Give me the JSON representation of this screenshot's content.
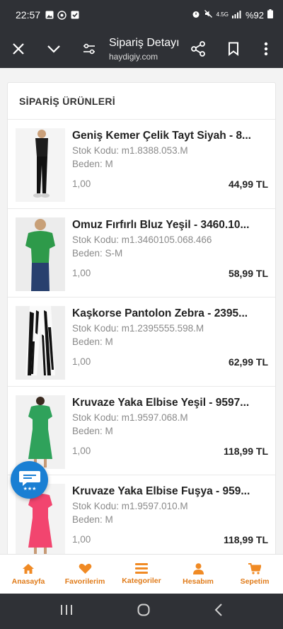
{
  "status": {
    "time": "22:57",
    "network": "4.5G",
    "battery": "%92"
  },
  "toolbar": {
    "title": "Sipariş Detayı",
    "url": "haydigiy.com"
  },
  "section_title": "SİPARİŞ ÜRÜNLERİ",
  "items": [
    {
      "name": "Geniş Kemer Çelik Tayt Siyah - 8...",
      "sku": "Stok Kodu: m1.8388.053.M",
      "size": "Beden: M",
      "qty": "1,00",
      "price": "44,99 TL",
      "image": "black-leggings"
    },
    {
      "name": "Omuz Fırfırlı Bluz Yeşil - 3460.10...",
      "sku": "Stok Kodu: m1.3460105.068.466",
      "size": "Beden: S-M",
      "qty": "1,00",
      "price": "58,99 TL",
      "image": "green-blouse"
    },
    {
      "name": "Kaşkorse Pantolon Zebra - 2395...",
      "sku": "Stok Kodu: m1.2395555.598.M",
      "size": "Beden: M",
      "qty": "1,00",
      "price": "62,99 TL",
      "image": "zebra-pants"
    },
    {
      "name": "Kruvaze Yaka Elbise Yeşil - 9597...",
      "sku": "Stok Kodu: m1.9597.068.M",
      "size": "Beden: M",
      "qty": "1,00",
      "price": "118,99 TL",
      "image": "green-dress"
    },
    {
      "name": "Kruvaze Yaka Elbise Fuşya - 959...",
      "sku": "Stok Kodu: m1.9597.010.M",
      "size": "Beden: M",
      "qty": "1,00",
      "price": "118,99 TL",
      "image": "pink-dress"
    }
  ],
  "bottom_nav": [
    {
      "label": "Anasayfa",
      "icon": "home-icon"
    },
    {
      "label": "Favorilerim",
      "icon": "heart-icon"
    },
    {
      "label": "Kategoriler",
      "icon": "menu-icon"
    },
    {
      "label": "Hesabım",
      "icon": "user-icon"
    },
    {
      "label": "Sepetim",
      "icon": "cart-icon"
    }
  ],
  "colors": {
    "accent": "#f08a24",
    "chrome": "#2f3136",
    "chat": "#1a7fd3"
  }
}
